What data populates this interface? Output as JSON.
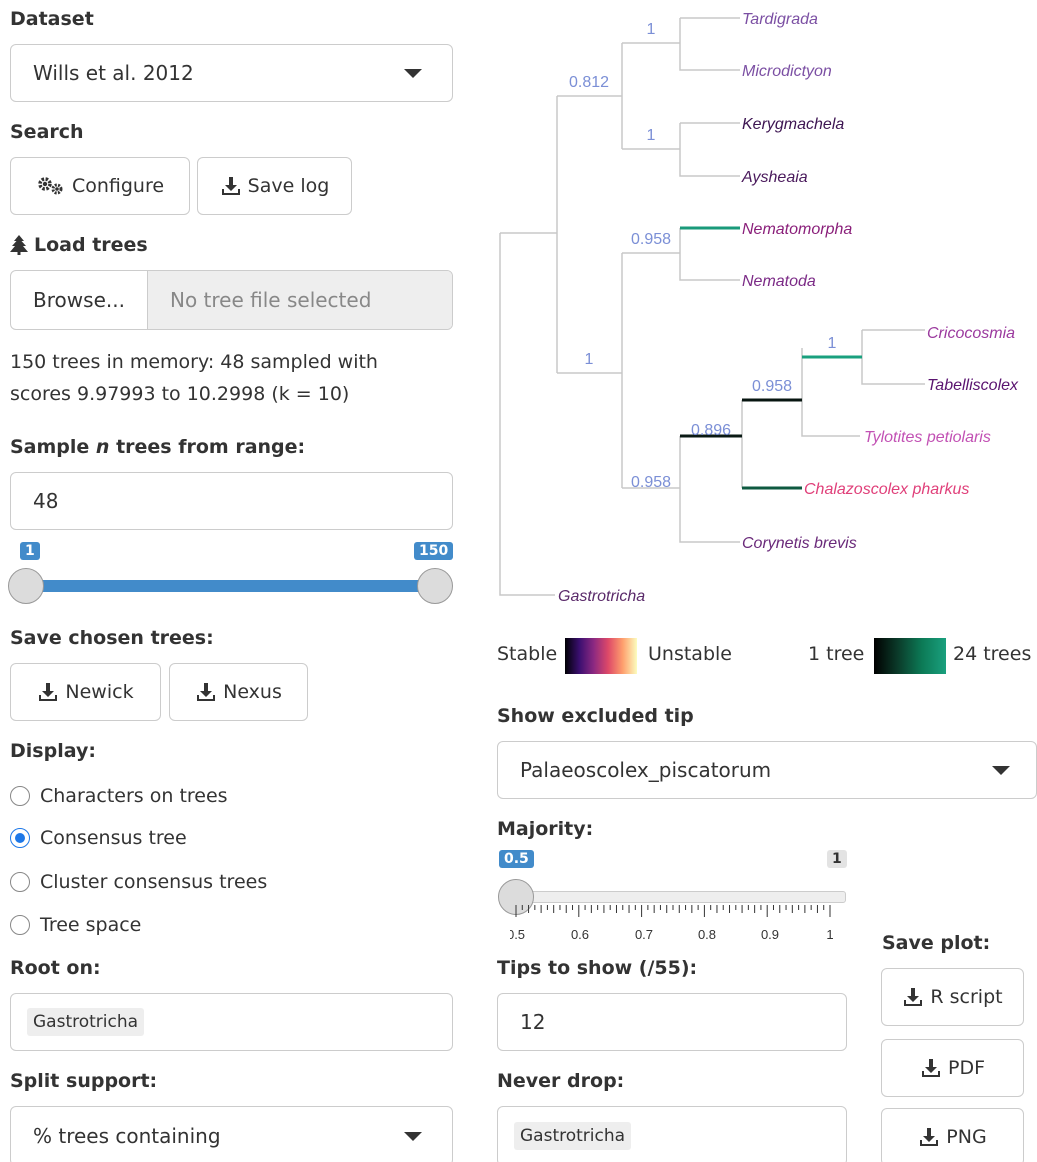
{
  "dataset": {
    "label": "Dataset",
    "value": "Wills et al. 2012"
  },
  "search": {
    "label": "Search",
    "configure": "Configure",
    "save_log": "Save log"
  },
  "load_trees": {
    "label": "Load trees",
    "browse": "Browse...",
    "placeholder": "No tree file selected"
  },
  "memory_info": {
    "line1": "150 trees in memory: 48 sampled with",
    "line2": "scores 9.97993 to 10.2998 (k = 10)"
  },
  "sample": {
    "label_pre": "Sample ",
    "label_n": "n",
    "label_post": " trees from range:",
    "value": "48",
    "range_min": "1",
    "range_max": "150"
  },
  "save_trees": {
    "label": "Save chosen trees:",
    "newick": "Newick",
    "nexus": "Nexus"
  },
  "display": {
    "label": "Display:",
    "options": [
      "Characters on trees",
      "Consensus tree",
      "Cluster consensus trees",
      "Tree space"
    ],
    "selected_index": 1
  },
  "root_on": {
    "label": "Root on:",
    "value": "Gastrotricha"
  },
  "split_support": {
    "label": "Split support:",
    "value": "% trees containing"
  },
  "tree": {
    "tips": [
      {
        "name": "Tardigrada",
        "color": "#7b4fa3"
      },
      {
        "name": "Microdictyon",
        "color": "#7b4fa3"
      },
      {
        "name": "Kerygmachela",
        "color": "#3d1552"
      },
      {
        "name": "Aysheaia",
        "color": "#4a1a5c"
      },
      {
        "name": "Nematomorpha",
        "color": "#8a1f7a"
      },
      {
        "name": "Nematoda",
        "color": "#7b2a86"
      },
      {
        "name": "Cricocosmia",
        "color": "#9b3a9e"
      },
      {
        "name": "Tabelliscolex",
        "color": "#5a1470"
      },
      {
        "name": "Tylotites petiolaris",
        "color": "#c251b4"
      },
      {
        "name": "Chalazoscolex pharkus",
        "color": "#e0407a"
      },
      {
        "name": "Corynetis brevis",
        "color": "#6a2a7a"
      },
      {
        "name": "Gastrotricha",
        "color": "#5a2a6a"
      }
    ],
    "supports": [
      "1",
      "0.812",
      "1",
      "0.958",
      "1",
      "1",
      "0.958",
      "0.896",
      "0.958"
    ]
  },
  "legend": {
    "stable": "Stable",
    "unstable": "Unstable",
    "one_tree": "1 tree",
    "many_trees": "24 trees"
  },
  "excluded_tip": {
    "label": "Show excluded tip",
    "value": "Palaeoscolex_piscatorum"
  },
  "majority": {
    "label": "Majority:",
    "value": "0.5",
    "max": "1",
    "ticks": [
      "0.5",
      "0.6",
      "0.7",
      "0.8",
      "0.9",
      "1"
    ]
  },
  "tips_to_show": {
    "label": "Tips to show (/55):",
    "value": "12"
  },
  "never_drop": {
    "label": "Never drop:",
    "value": "Gastrotricha"
  },
  "save_plot": {
    "label": "Save plot:",
    "r_script": "R script",
    "pdf": "PDF",
    "png": "PNG"
  },
  "colors": {
    "accent": "#428bca",
    "radio": "#1e78e8",
    "support_text": "#7b8fd6"
  }
}
